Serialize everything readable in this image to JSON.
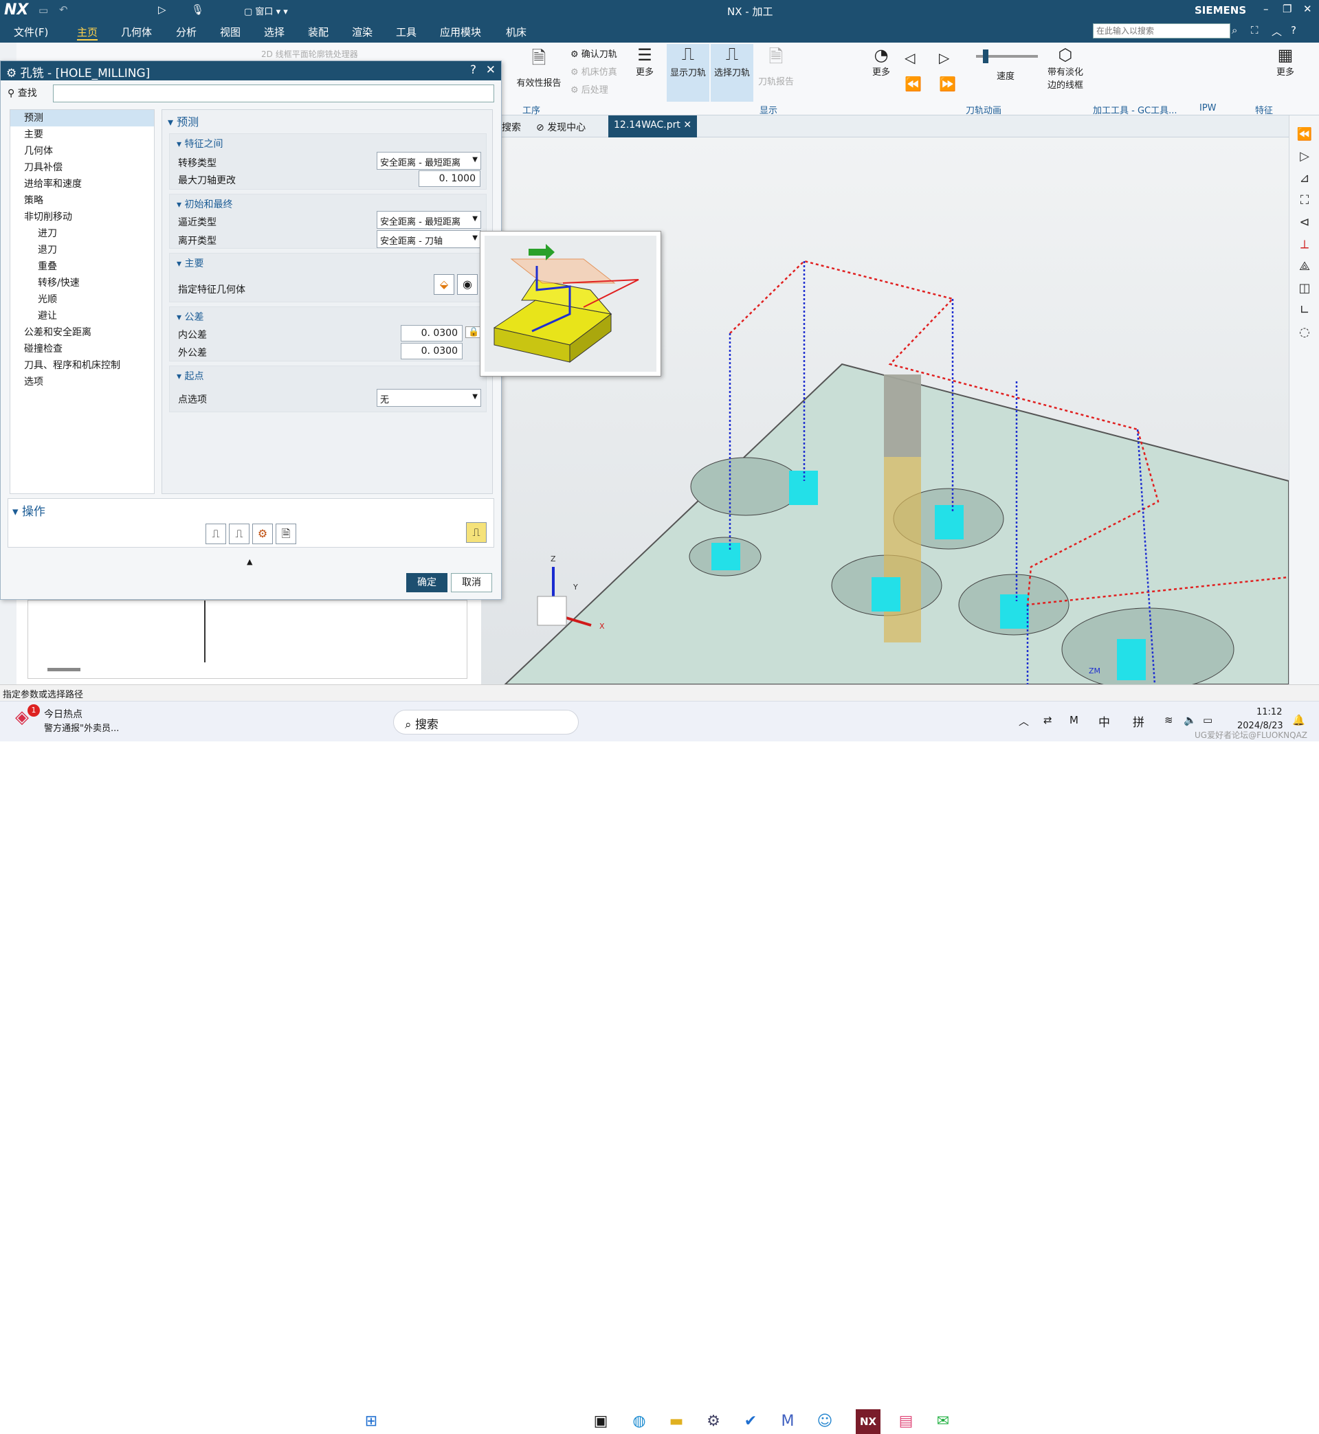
{
  "app": {
    "logo": "NX",
    "title": "NX - 加工",
    "brand": "SIEMENS",
    "quick_window": "窗口"
  },
  "menu": [
    "文件(F)",
    "主页",
    "几何体",
    "分析",
    "视图",
    "选择",
    "装配",
    "渲染",
    "工具",
    "应用模块",
    "机床"
  ],
  "search": {
    "placeholder": "在此输入以搜索"
  },
  "ribbon": {
    "faded_label": "2D 线框平面轮廓铣处理器",
    "gongxu": {
      "validity": "有效性报告",
      "confirm": "确认刀轨",
      "machine_sim": "机床仿真",
      "post": "后处理",
      "more": "更多",
      "group": "工序"
    },
    "display": {
      "show_path": "显示刀轨",
      "select_path": "选择刀轨",
      "report": "刀轨报告",
      "more": "更多",
      "group": "显示"
    },
    "anim": {
      "speed": "速度",
      "wireframe1": "带有淡化",
      "wireframe2": "边的线框",
      "group": "刀轨动画"
    },
    "gc": {
      "group": "加工工具 - GC工具..."
    },
    "ipw": {
      "group": "IPW"
    },
    "feature": {
      "more": "更多",
      "group": "特征"
    }
  },
  "tabs": {
    "search": "搜索",
    "discover": "发现中心",
    "file": "12.14WAC.prt"
  },
  "dialog": {
    "title": "孔铣 - [HOLE_MILLING]",
    "find_label": "查找",
    "tree": [
      "预测",
      "主要",
      "几何体",
      "刀具补偿",
      "进给率和速度",
      "策略",
      "非切削移动",
      "进刀",
      "退刀",
      "重叠",
      "转移/快速",
      "光顺",
      "避让",
      "公差和安全距离",
      "碰撞检查",
      "刀具、程序和机床控制",
      "选项"
    ],
    "panel_title": "预测",
    "sec1": {
      "head": "特征之间",
      "transfer_label": "转移类型",
      "transfer_value": "安全距离 - 最短距离",
      "max_axis_label": "最大刀轴更改",
      "max_axis_value": "0. 1000"
    },
    "sec2": {
      "head": "初始和最终",
      "approach_label": "逼近类型",
      "approach_value": "安全距离 - 最短距离",
      "leave_label": "离开类型",
      "leave_value": "安全距离 - 刀轴"
    },
    "sec3": {
      "head": "主要",
      "feature_geom_label": "指定特征几何体"
    },
    "sec4": {
      "head": "公差",
      "inner_label": "内公差",
      "inner_value": "0. 0300",
      "outer_label": "外公差",
      "outer_value": "0. 0300"
    },
    "sec5": {
      "head": "起点",
      "point_label": "点选项",
      "point_value": "无"
    },
    "ops_head": "操作",
    "ok": "确定",
    "cancel": "取消"
  },
  "status": "指定参数或选择路径",
  "triad": {
    "z": "Z",
    "y": "Y",
    "x": "X",
    "zm": "ZM"
  },
  "taskbar": {
    "news_title": "今日热点",
    "news_sub": "警方通报\"外卖员...",
    "badge": "1",
    "search": "搜索",
    "ime1": "中",
    "ime2": "拼",
    "time": "11:12",
    "date": "2024/8/23",
    "watermark": "UG爱好者论坛@FLUOKNQAZ"
  },
  "colors": {
    "accent": "#1d4f70",
    "path_red": "#e02020",
    "path_blue": "#1f2fd0",
    "tool_cyan": "#23e0e8"
  }
}
